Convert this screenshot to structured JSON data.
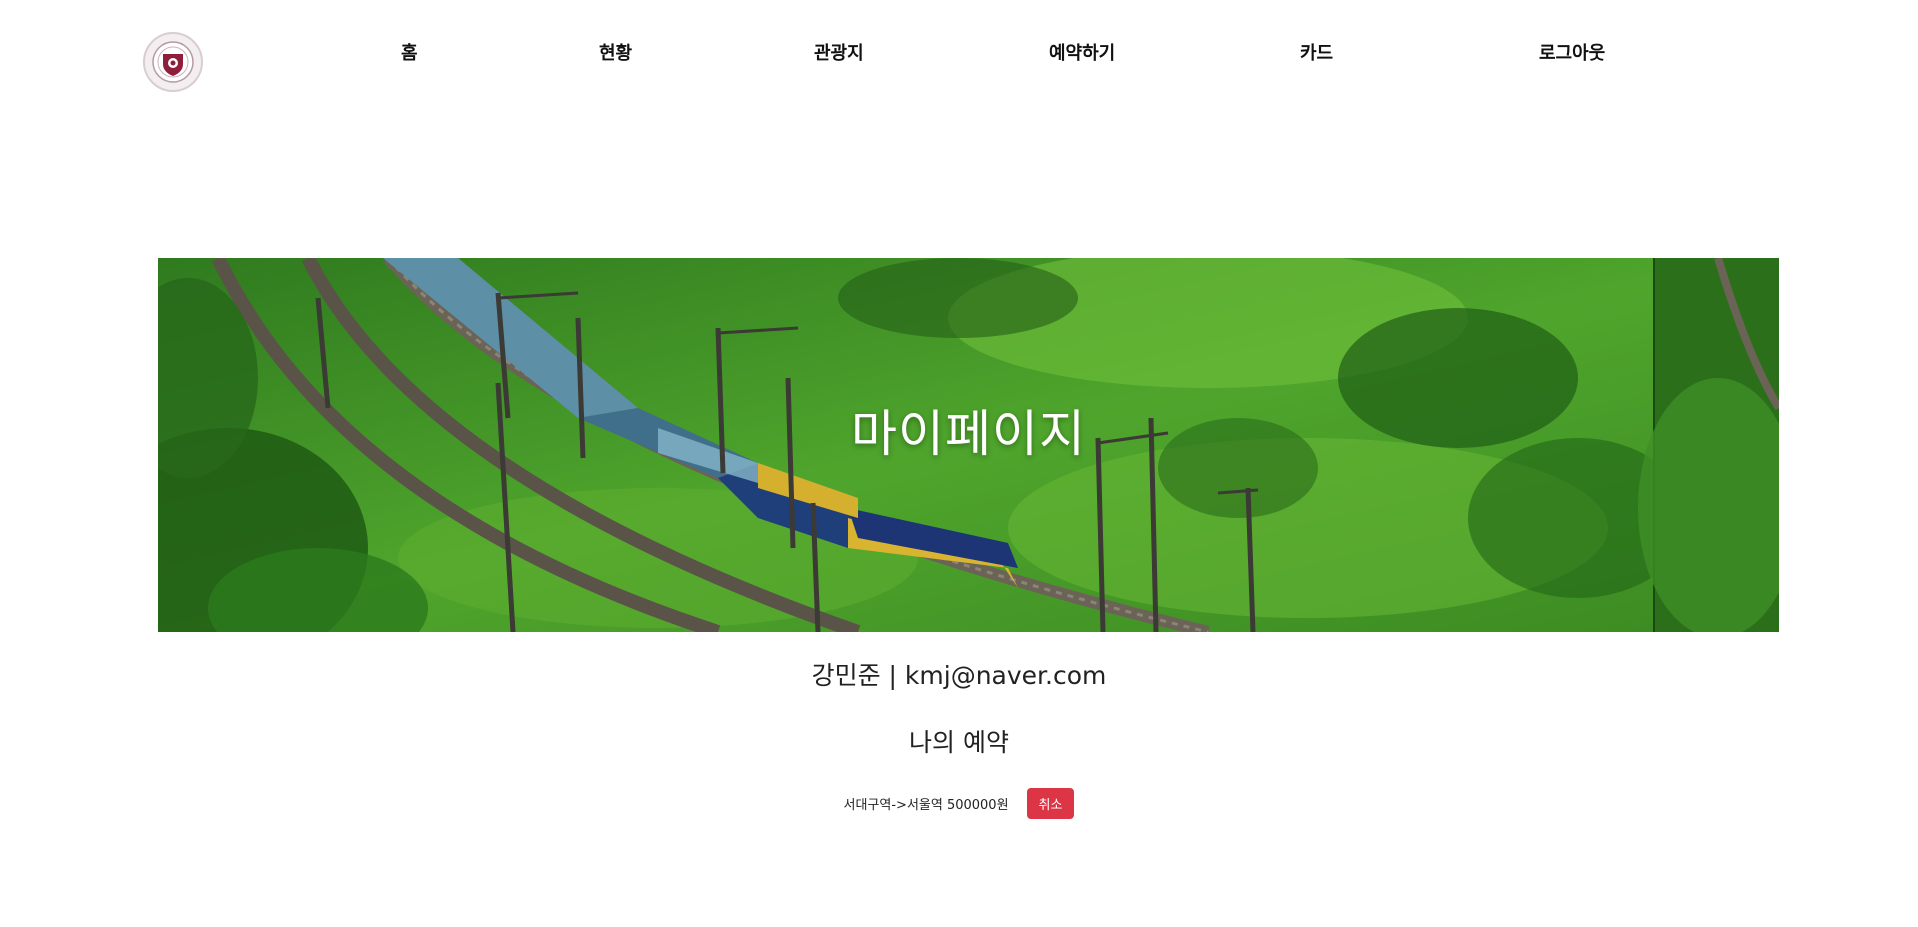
{
  "nav": {
    "logo_icon": "university-seal-icon",
    "items": [
      {
        "label": "홈"
      },
      {
        "label": "현황"
      },
      {
        "label": "관광지"
      },
      {
        "label": "예약하기"
      },
      {
        "label": "카드"
      },
      {
        "label": "로그아웃"
      }
    ]
  },
  "hero": {
    "title": "마이페이지",
    "image": "train-through-green-hills-photo"
  },
  "profile": {
    "info": "강민준 | kmj@naver.com"
  },
  "reservations": {
    "title": "나의 예약",
    "items": [
      {
        "text": "서대구역->서울역 500000원",
        "cancel_label": "취소"
      }
    ]
  },
  "colors": {
    "cancel_button": "#dc3545",
    "logo": "#8e1e3c"
  }
}
